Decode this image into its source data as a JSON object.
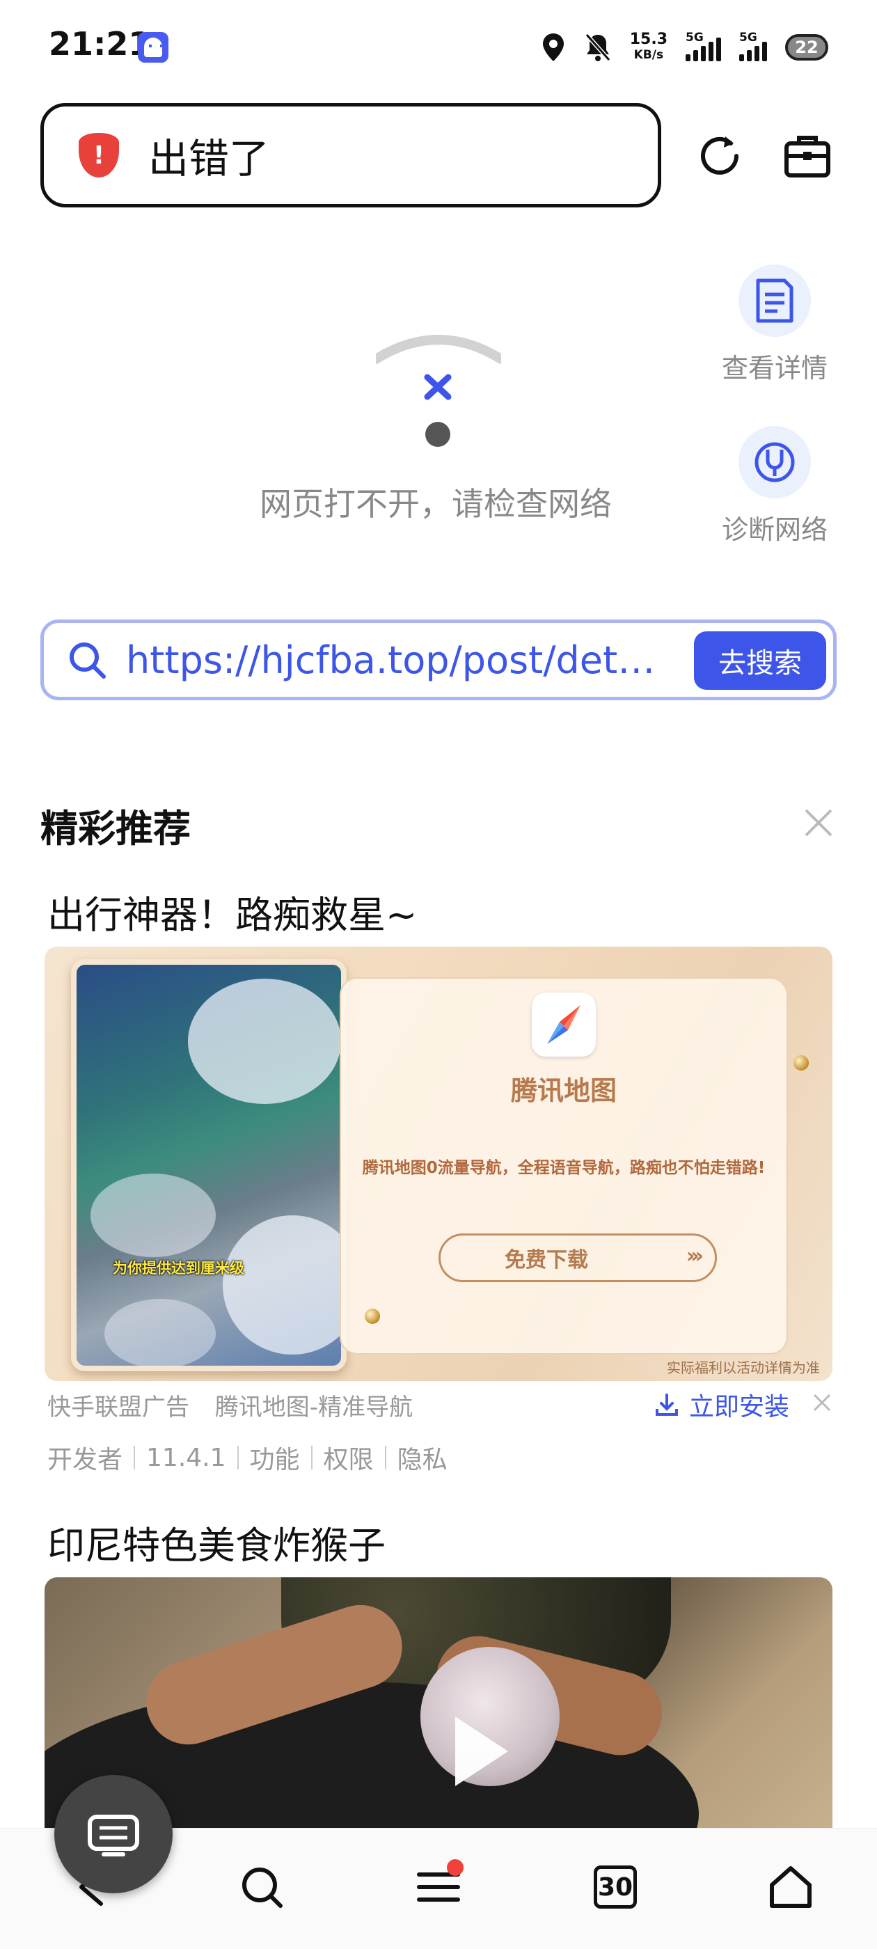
{
  "status_bar": {
    "time": "21:21",
    "net_speed": "15.3",
    "net_unit": "KB/s",
    "sim1": "5G",
    "sim2": "5G",
    "battery": "22"
  },
  "top_bar": {
    "title": "出错了",
    "shield_icon": "alert-shield-icon"
  },
  "error": {
    "message": "网页打不开，请检查网络",
    "actions": [
      {
        "label": "查看详情",
        "icon": "document-icon"
      },
      {
        "label": "诊断网络",
        "icon": "stethoscope-icon"
      }
    ]
  },
  "search": {
    "url": "https://hjcfba.top/post/detail…",
    "button": "去搜索"
  },
  "recommend": {
    "section_title": "精彩推荐",
    "ad": {
      "title": "出行神器！路痴救星~",
      "banner_brand": "腾讯地图",
      "banner_desc": "腾讯地图0流量导航，全程语音导航，路痴也不怕走错路!",
      "banner_button": "免费下载",
      "banner_fine_print": "实际福利以活动详情为准",
      "banner_caption": "为你提供达到厘米级",
      "source": "快手联盟广告",
      "app_name": "腾讯地图-精准导航",
      "install": "立即安装",
      "dev_items": [
        "开发者",
        "11.4.1",
        "功能",
        "权限",
        "隐私"
      ]
    },
    "video": {
      "title": "印尼特色美食炸猴子"
    }
  },
  "bottom_nav": {
    "tabs_count": "30",
    "colors": {
      "accent": "#3d55e8",
      "danger": "#e8413c"
    }
  }
}
